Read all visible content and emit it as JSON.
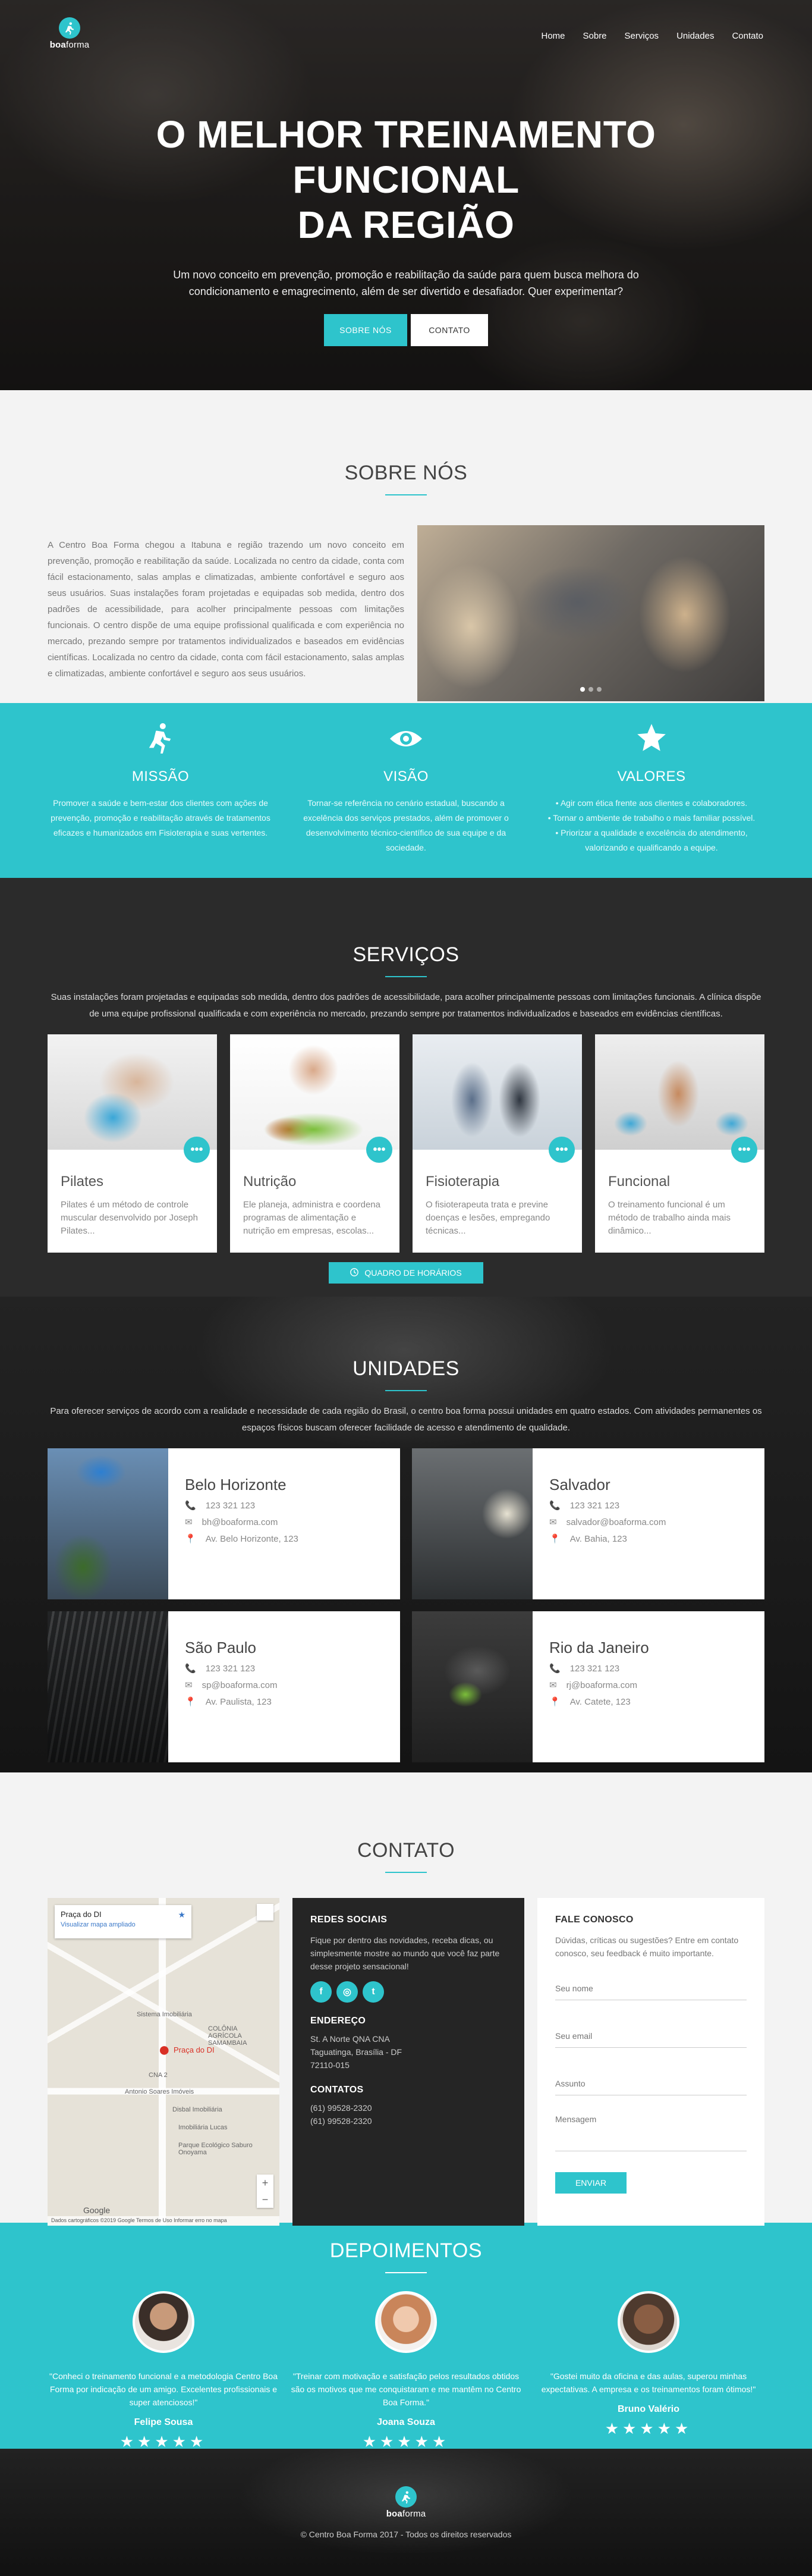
{
  "brand": {
    "name_bold": "boa",
    "name_rest": "forma"
  },
  "nav": [
    "Home",
    "Sobre",
    "Serviços",
    "Unidades",
    "Contato"
  ],
  "hero": {
    "title_line1": "O MELHOR TREINAMENTO FUNCIONAL",
    "title_line2": "DA REGIÃO",
    "subtitle": "Um novo conceito em prevenção, promoção e reabilitação da saúde para quem busca melhora do condicionamento e emagrecimento, além de ser divertido e desafiador. Quer experimentar?",
    "btn_sobre": "SOBRE NÓS",
    "btn_contato": "CONTATO"
  },
  "sobre": {
    "title": "SOBRE NÓS",
    "text": "A Centro Boa Forma chegou a Itabuna e região trazendo um novo conceito em prevenção, promoção e reabilitação da saúde. Localizada no centro da cidade, conta com fácil estacionamento, salas amplas e climatizadas, ambiente confortável e seguro aos seus usuários. Suas instalações foram projetadas e equipadas sob medida, dentro dos padrões de acessibilidade, para acolher principalmente pessoas com limitações funcionais. O centro dispõe de uma equipe profissional qualificada e com experiência no mercado, prezando sempre por tratamentos individualizados e baseados em evidências científicas. Localizada no centro da cidade, conta com fácil estacionamento, salas amplas e climatizadas, ambiente confortável e seguro aos seus usuários."
  },
  "mvv": [
    {
      "icon": "running-icon",
      "title": "MISSÃO",
      "text": "Promover a saúde e bem-estar dos clientes com ações de prevenção, promoção e reabilitação através de tratamentos eficazes e humanizados em Fisioterapia e suas vertentes."
    },
    {
      "icon": "eye-icon",
      "title": "VISÃO",
      "text": "Tornar-se referência no cenário estadual, buscando a excelência dos serviços prestados, além de promover o desenvolvimento técnico-científico de sua equipe e da sociedade."
    },
    {
      "icon": "star-icon",
      "title": "VALORES",
      "text": "• Agir com ética frente aos clientes e colaboradores.\n• Tornar o ambiente de trabalho o mais familiar possível.\n• Priorizar a qualidade e excelência do atendimento, valorizando e qualificando a equipe."
    }
  ],
  "servicos": {
    "title": "SERVIÇOS",
    "intro": "Suas instalações foram projetadas e equipadas sob medida, dentro dos padrões de acessibilidade, para acolher principalmente pessoas com limitações funcionais. A clínica dispõe de uma equipe profissional qualificada e com experiência no mercado, prezando sempre por tratamentos individualizados e baseados em evidências científicas.",
    "cards": [
      {
        "title": "Pilates",
        "text": "Pilates é um método de controle muscular desenvolvido por Joseph Pilates..."
      },
      {
        "title": "Nutrição",
        "text": "Ele planeja, administra e coordena programas de alimentação e nutrição em empresas, escolas..."
      },
      {
        "title": "Fisioterapia",
        "text": "O fisioterapeuta trata e previne doenças e lesões, empregando técnicas..."
      },
      {
        "title": "Funcional",
        "text": "O treinamento funcional é um método de trabalho ainda mais dinâmico..."
      }
    ],
    "more_label": "•••",
    "schedule_button": "QUADRO DE HORÁRIOS"
  },
  "unidades": {
    "title": "UNIDADES",
    "intro": "Para oferecer serviços de acordo com a realidade e necessidade de cada região do Brasil, o centro boa forma possui unidades em quatro estados. Com atividades permanentes os espaços físicos buscam oferecer facilidade de acesso e atendimento de qualidade.",
    "units": [
      {
        "name": "Belo Horizonte",
        "phone": "123 321 123",
        "email": "bh@boaforma.com",
        "address": "Av. Belo Horizonte, 123"
      },
      {
        "name": "Salvador",
        "phone": "123 321 123",
        "email": "salvador@boaforma.com",
        "address": "Av. Bahia, 123"
      },
      {
        "name": "São Paulo",
        "phone": "123 321 123",
        "email": "sp@boaforma.com",
        "address": "Av. Paulista, 123"
      },
      {
        "name": "Rio da Janeiro",
        "phone": "123 321 123",
        "email": "rj@boaforma.com",
        "address": "Av. Catete, 123"
      }
    ]
  },
  "contato": {
    "title": "CONTATO",
    "map": {
      "place": "Praça do DI",
      "link": "Visualizar mapa ampliado",
      "pin_label": "Praça do DI",
      "labels": [
        "Sistema Imobiliária",
        "COLÔNIA AGRÍCOLA SAMAMBAIA",
        "CNA 2",
        "Antonio Soares Imóveis",
        "Disbal Imobiliária",
        "Parque Ecológico Saburo Onoyama",
        "Imobiliária Lucas"
      ],
      "footer": "Dados cartográficos ©2019 Google   Termos de Uso   Informar erro no mapa",
      "google": "Google"
    },
    "social": {
      "heading": "REDES SOCIAIS",
      "text": "Fique por dentro das novidades, receba dicas, ou simplesmente mostre ao mundo que você faz parte desse projeto sensacional!",
      "icons": [
        "facebook-icon",
        "instagram-icon",
        "twitter-icon"
      ],
      "address_heading": "ENDEREÇO",
      "address_lines": [
        "St. A Norte QNA CNA",
        "Taguatinga, Brasília - DF",
        "72110-015"
      ],
      "contacts_heading": "CONTATOS",
      "phones": [
        "(61) 99528-2320",
        "(61) 99528-2320"
      ]
    },
    "form": {
      "heading": "FALE CONOSCO",
      "text": "Dúvidas, críticas ou sugestões? Entre em contato conosco, seu feedback é muito importante.",
      "name_placeholder": "Seu nome",
      "email_placeholder": "Seu email",
      "subject_placeholder": "Assunto",
      "message_placeholder": "Mensagem",
      "send_label": "ENVIAR"
    }
  },
  "depoimentos": {
    "title": "DEPOIMENTOS",
    "items": [
      {
        "quote": "\"Conheci o treinamento funcional e a metodologia Centro Boa Forma por indicação de um amigo. Excelentes profissionais e super atenciosos!\"",
        "name": "Felipe Sousa",
        "stars": "★★★★★"
      },
      {
        "quote": "\"Treinar com motivação e satisfação pelos resultados obtidos são os motivos que me conquistaram e me mantêm no Centro Boa Forma.\"",
        "name": "Joana Souza",
        "stars": "★★★★★"
      },
      {
        "quote": "\"Gostei muito da oficina e das aulas, superou minhas expectativas. A empresa e os treinamentos foram ótimos!\"",
        "name": "Bruno Valério",
        "stars": "★★★★★"
      }
    ]
  },
  "footer": {
    "copyright": "© Centro Boa Forma 2017 - Todos os direitos reservados"
  },
  "colors": {
    "accent": "#2ec4cc",
    "dark": "#2b2b2b"
  }
}
